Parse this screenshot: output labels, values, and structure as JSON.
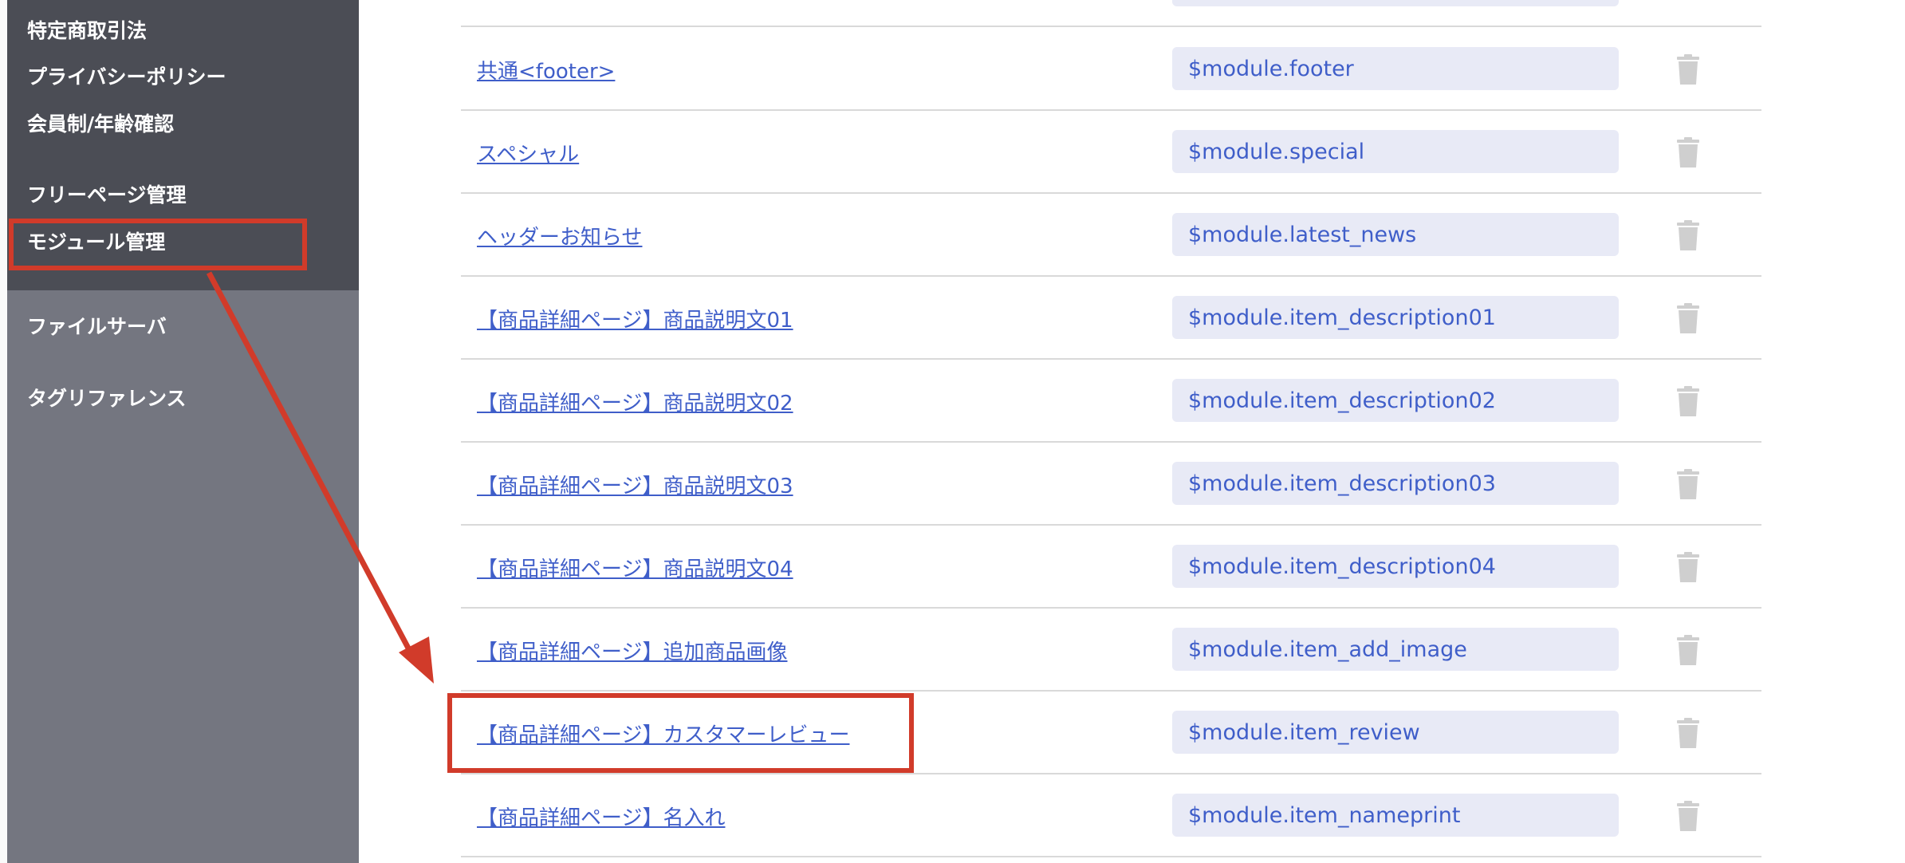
{
  "sidebar": {
    "items": [
      {
        "label": "特定商取引法"
      },
      {
        "label": "プライバシーポリシー"
      },
      {
        "label": "会員制/年齢確認"
      },
      {
        "label": "フリーページ管理"
      },
      {
        "label": "モジュール管理"
      },
      {
        "label": "ファイルサーバ"
      },
      {
        "label": "タグリファレンス"
      }
    ]
  },
  "modules": [
    {
      "name": "共通<footer>",
      "variable": "$module.footer"
    },
    {
      "name": "スペシャル",
      "variable": "$module.special"
    },
    {
      "name": "ヘッダーお知らせ",
      "variable": "$module.latest_news"
    },
    {
      "name": "【商品詳細ページ】商品説明文01",
      "variable": "$module.item_description01"
    },
    {
      "name": "【商品詳細ページ】商品説明文02",
      "variable": "$module.item_description02"
    },
    {
      "name": "【商品詳細ページ】商品説明文03",
      "variable": "$module.item_description03"
    },
    {
      "name": "【商品詳細ページ】商品説明文04",
      "variable": "$module.item_description04"
    },
    {
      "name": "【商品詳細ページ】追加商品画像",
      "variable": "$module.item_add_image"
    },
    {
      "name": "【商品詳細ページ】カスタマーレビュー",
      "variable": "$module.item_review"
    },
    {
      "name": "【商品詳細ページ】名入れ",
      "variable": "$module.item_nameprint"
    }
  ],
  "icons": {
    "delete": "trash-icon"
  },
  "colors": {
    "sidebar_dark": "#4b4d55",
    "sidebar_light": "#747680",
    "link": "#3f5ec9",
    "variable_bg": "#e8eaf6",
    "annotation": "#d13b2a",
    "trash": "#cfcfcf"
  }
}
